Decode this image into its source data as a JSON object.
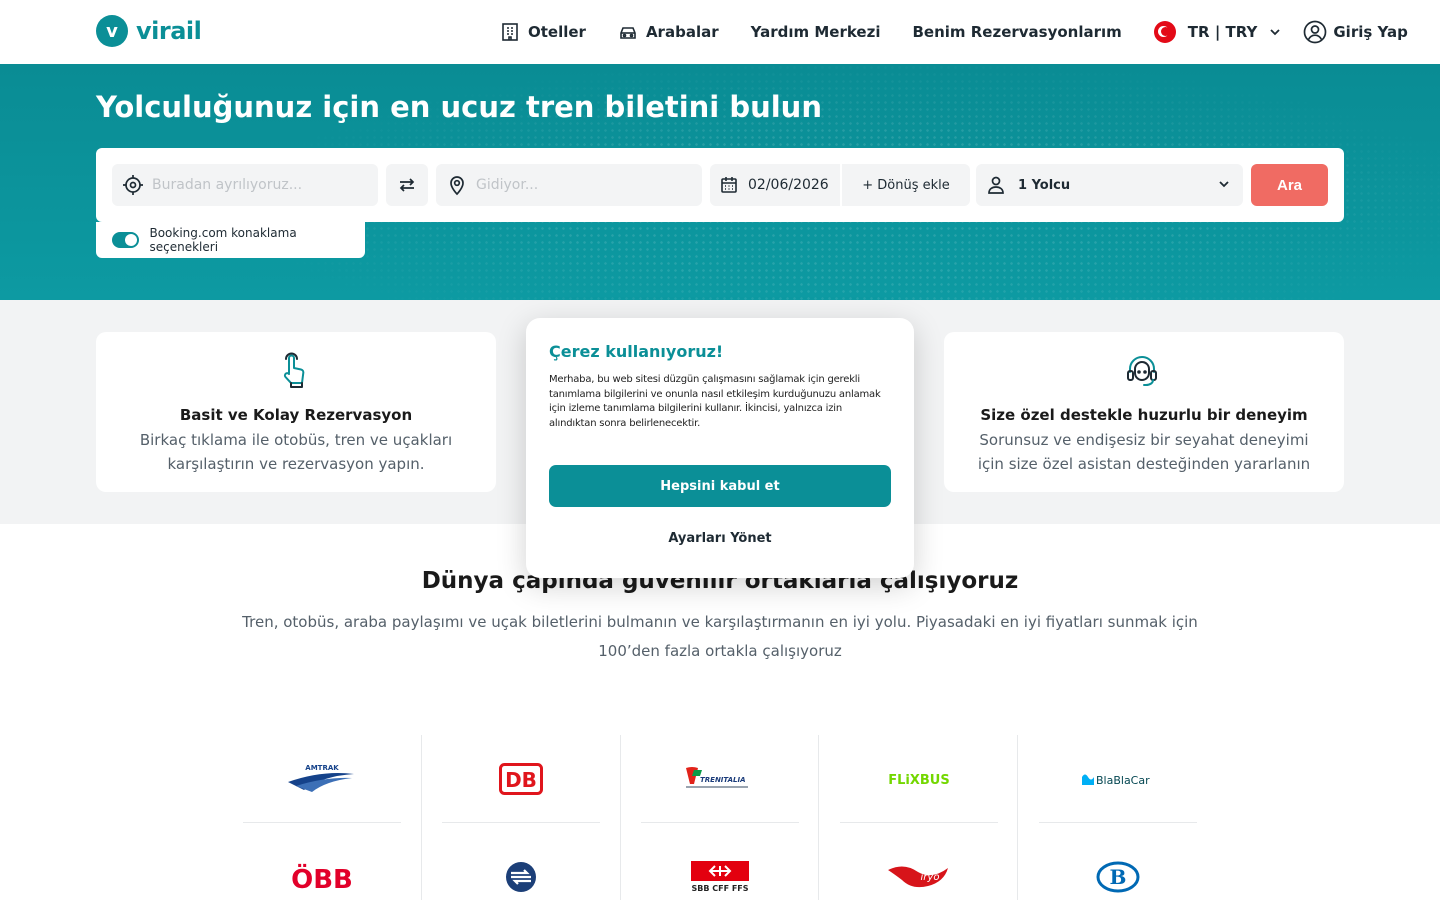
{
  "brand": {
    "logo_letter": "v",
    "name": "virail"
  },
  "nav": {
    "hotels": "Oteller",
    "cars": "Arabalar",
    "help": "Yardım Merkezi",
    "bookings": "Benim Rezervasyonlarım",
    "language": "TR",
    "currency": "TRY",
    "login": "Giriş Yap"
  },
  "hero": {
    "title": "Yolculuğunuz için en ucuz tren biletini bulun"
  },
  "search": {
    "from_placeholder": "Buradan ayrılıyoruz...",
    "to_placeholder": "Gidiyor...",
    "date": "02/06/2026",
    "return_label": "+ Dönüş ekle",
    "passengers": "1 Yolcu",
    "search_button": "Ara",
    "booking_toggle_label": "Booking.com konaklama seçenekleri",
    "booking_toggle_on": true
  },
  "features": {
    "left": {
      "title": "Basit ve Kolay Rezervasyon",
      "description": "Birkaç tıklama ile otobüs, tren ve uçakları karşılaştırın ve rezervasyon yapın."
    },
    "right": {
      "title": "Size özel destekle huzurlu bir deneyim",
      "description": "Sorunsuz ve endişesiz bir seyahat deneyimi için size özel asistan desteğinden yararlanın"
    }
  },
  "partners": {
    "title": "Dünya çapında güvenilir ortaklarla çalışıyoruz",
    "description": "Tren, otobüs, araba paylaşımı ve uçak biletlerini bulmanın ve karşılaştırmanın en iyi yolu. Piyasadaki en iyi fiyatları sunmak için 100’den fazla ortakla çalışıyoruz",
    "logos": [
      {
        "label": "AMTRAK",
        "icon": "amtrak-logo"
      },
      {
        "label": "DB",
        "icon": "db-logo"
      },
      {
        "label": "TRENITALIA",
        "icon": "trenitalia-logo"
      },
      {
        "label": "FLiXBUS",
        "icon": "flixbus-logo"
      },
      {
        "label": "BlaBlaCar",
        "icon": "blablacar-logo"
      },
      {
        "label": "ÖBB",
        "icon": "obb-logo"
      },
      {
        "label": "",
        "icon": "national-rail-logo"
      },
      {
        "label": "SBB CFF FFS",
        "icon": "sbb-logo"
      },
      {
        "label": "iryo",
        "icon": "iryo-logo"
      },
      {
        "label": "B",
        "icon": "sncb-logo"
      }
    ]
  },
  "cookie": {
    "title": "Çerez kullanıyoruz!",
    "text": "Merhaba, bu web sitesi düzgün çalışmasını sağlamak için gerekli tanımlama bilgilerini ve onunla nasıl etkileşim kurduğunuzu anlamak için izleme tanımlama bilgilerini kullanır. İkincisi, yalnızca izin alındıktan sonra belirlenecektir.",
    "accept": "Hepsini kabul et",
    "manage": "Ayarları Yönet"
  },
  "colors": {
    "primary": "#0b8f97",
    "accent": "#f06b63",
    "text": "#1e2a33",
    "muted": "#55606a"
  }
}
